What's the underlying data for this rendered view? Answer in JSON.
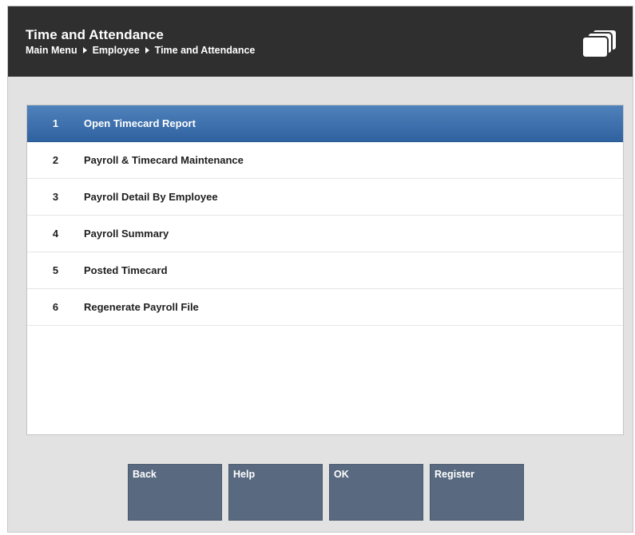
{
  "header": {
    "title": "Time and Attendance",
    "breadcrumb": [
      "Main Menu",
      "Employee",
      "Time and Attendance"
    ],
    "icon": "windows-icon"
  },
  "menu": {
    "items": [
      {
        "number": "1",
        "label": "Open Timecard Report",
        "selected": true
      },
      {
        "number": "2",
        "label": "Payroll & Timecard Maintenance"
      },
      {
        "number": "3",
        "label": "Payroll Detail By Employee"
      },
      {
        "number": "4",
        "label": "Payroll Summary"
      },
      {
        "number": "5",
        "label": "Posted Timecard"
      },
      {
        "number": "6",
        "label": "Regenerate Payroll File"
      }
    ]
  },
  "buttons": {
    "back": "Back",
    "help": "Help",
    "ok": "OK",
    "register": "Register"
  },
  "colors": {
    "header_bg": "#2f2f2f",
    "selected_row": "#3a6dab",
    "button_bg": "#596a80"
  }
}
